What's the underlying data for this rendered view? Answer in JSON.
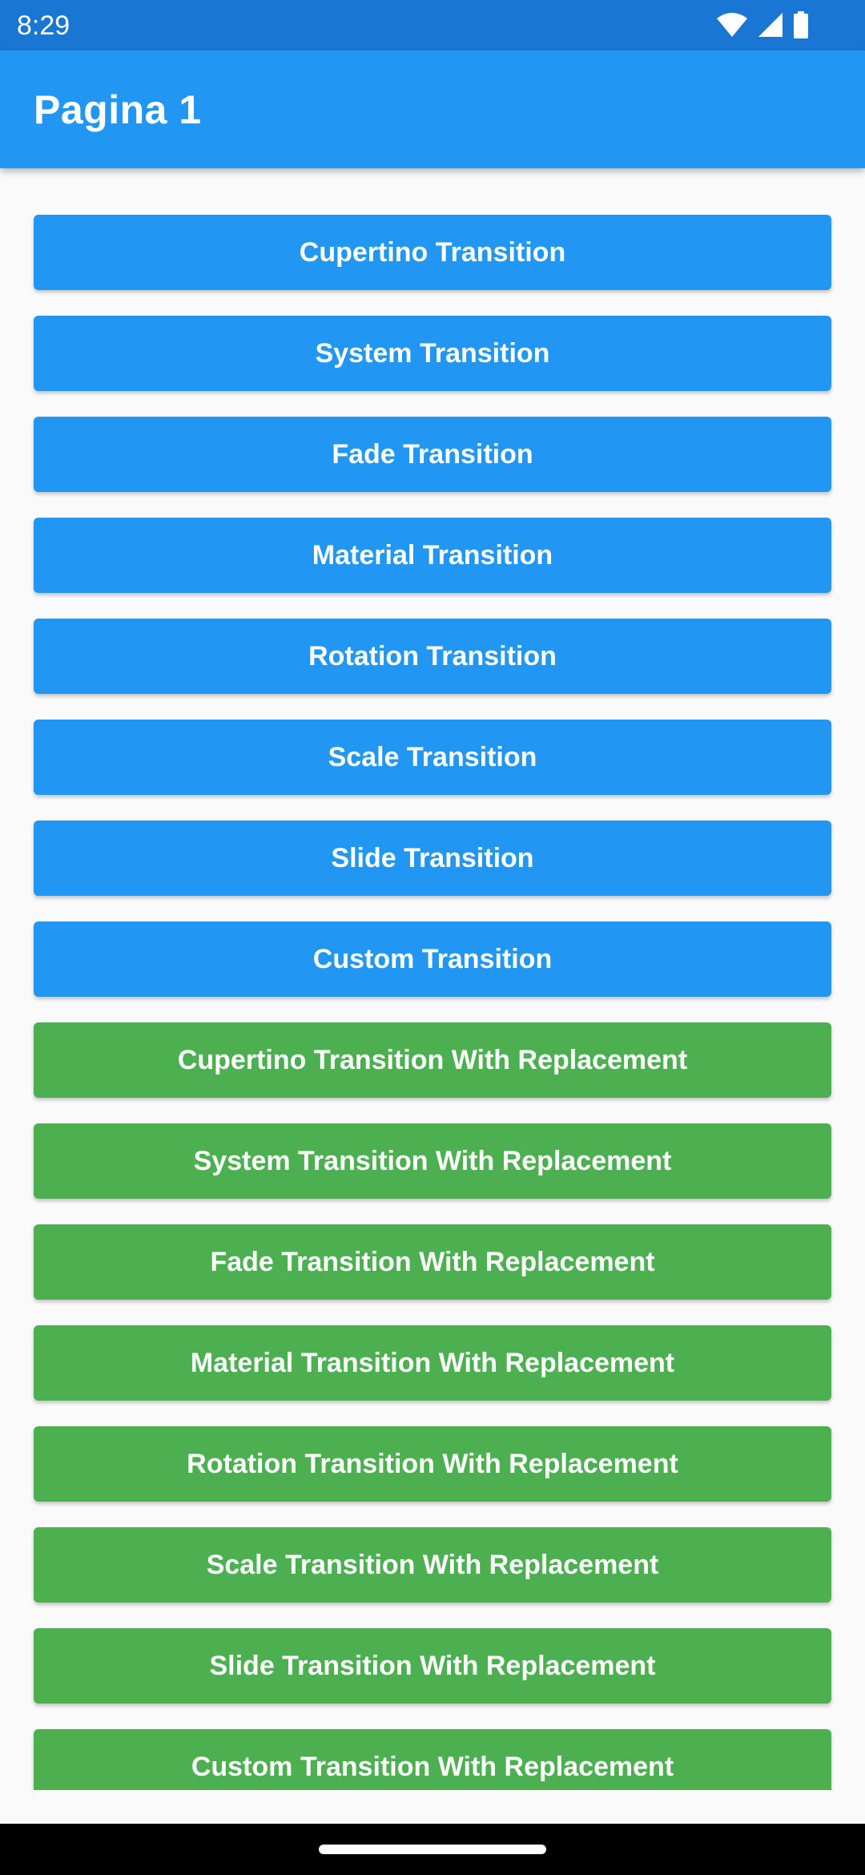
{
  "status_bar": {
    "time": "8:29",
    "icons": [
      "wifi-icon",
      "cellular-signal-icon",
      "battery-icon"
    ]
  },
  "app_bar": {
    "title": "Pagina 1",
    "color": "#2196f3"
  },
  "colors": {
    "status_bar": "#1976d2",
    "blue_button": "#2196f3",
    "green_button": "#4caf50",
    "background": "#fafafa"
  },
  "buttons": [
    {
      "label": "Cupertino Transition",
      "color": "blue"
    },
    {
      "label": "System Transition",
      "color": "blue"
    },
    {
      "label": "Fade Transition",
      "color": "blue"
    },
    {
      "label": "Material Transition",
      "color": "blue"
    },
    {
      "label": "Rotation Transition",
      "color": "blue"
    },
    {
      "label": "Scale Transition",
      "color": "blue"
    },
    {
      "label": "Slide Transition",
      "color": "blue"
    },
    {
      "label": "Custom Transition",
      "color": "blue"
    },
    {
      "label": "Cupertino Transition With Replacement",
      "color": "green"
    },
    {
      "label": "System Transition With Replacement",
      "color": "green"
    },
    {
      "label": "Fade Transition With Replacement",
      "color": "green"
    },
    {
      "label": "Material Transition With Replacement",
      "color": "green"
    },
    {
      "label": "Rotation Transition With Replacement",
      "color": "green"
    },
    {
      "label": "Scale Transition With Replacement",
      "color": "green"
    },
    {
      "label": "Slide Transition With Replacement",
      "color": "green"
    },
    {
      "label": "Custom Transition With Replacement",
      "color": "green"
    }
  ]
}
